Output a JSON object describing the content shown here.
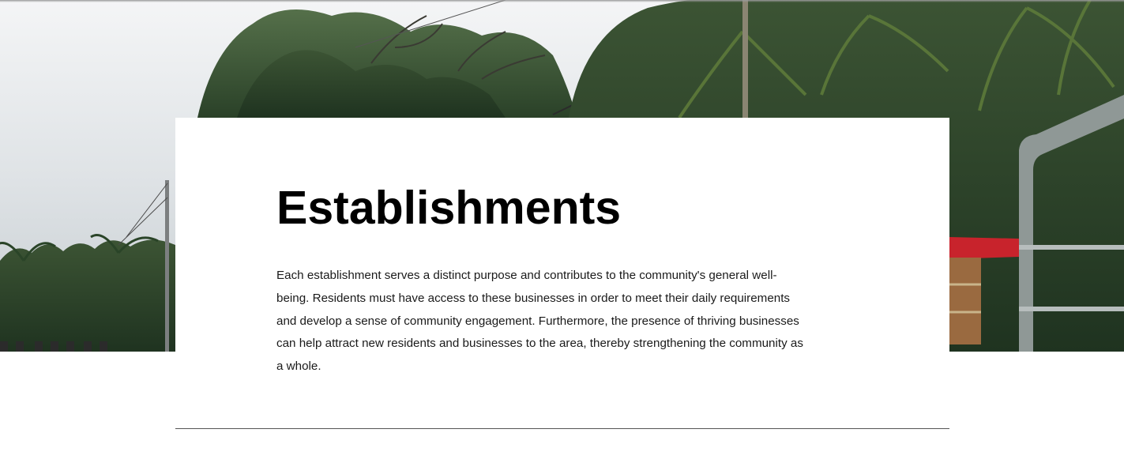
{
  "section": {
    "title": "Establishments",
    "description": "Each establishment serves a distinct purpose and contributes to the community's general well-being. Residents must have access to these businesses in order to meet their daily requirements and develop a sense of community engagement. Furthermore, the presence of thriving businesses can help attract new residents and businesses to the area, thereby strengthening the community as a whole."
  },
  "hero": {
    "image": "tropical-roadside-palm-trees-photo"
  },
  "colors": {
    "background": "#ffffff",
    "title": "#000000",
    "text": "#1a1a1a",
    "divider": "#555555",
    "foliage": "#2f4a2a",
    "roof": "#c8232c"
  }
}
